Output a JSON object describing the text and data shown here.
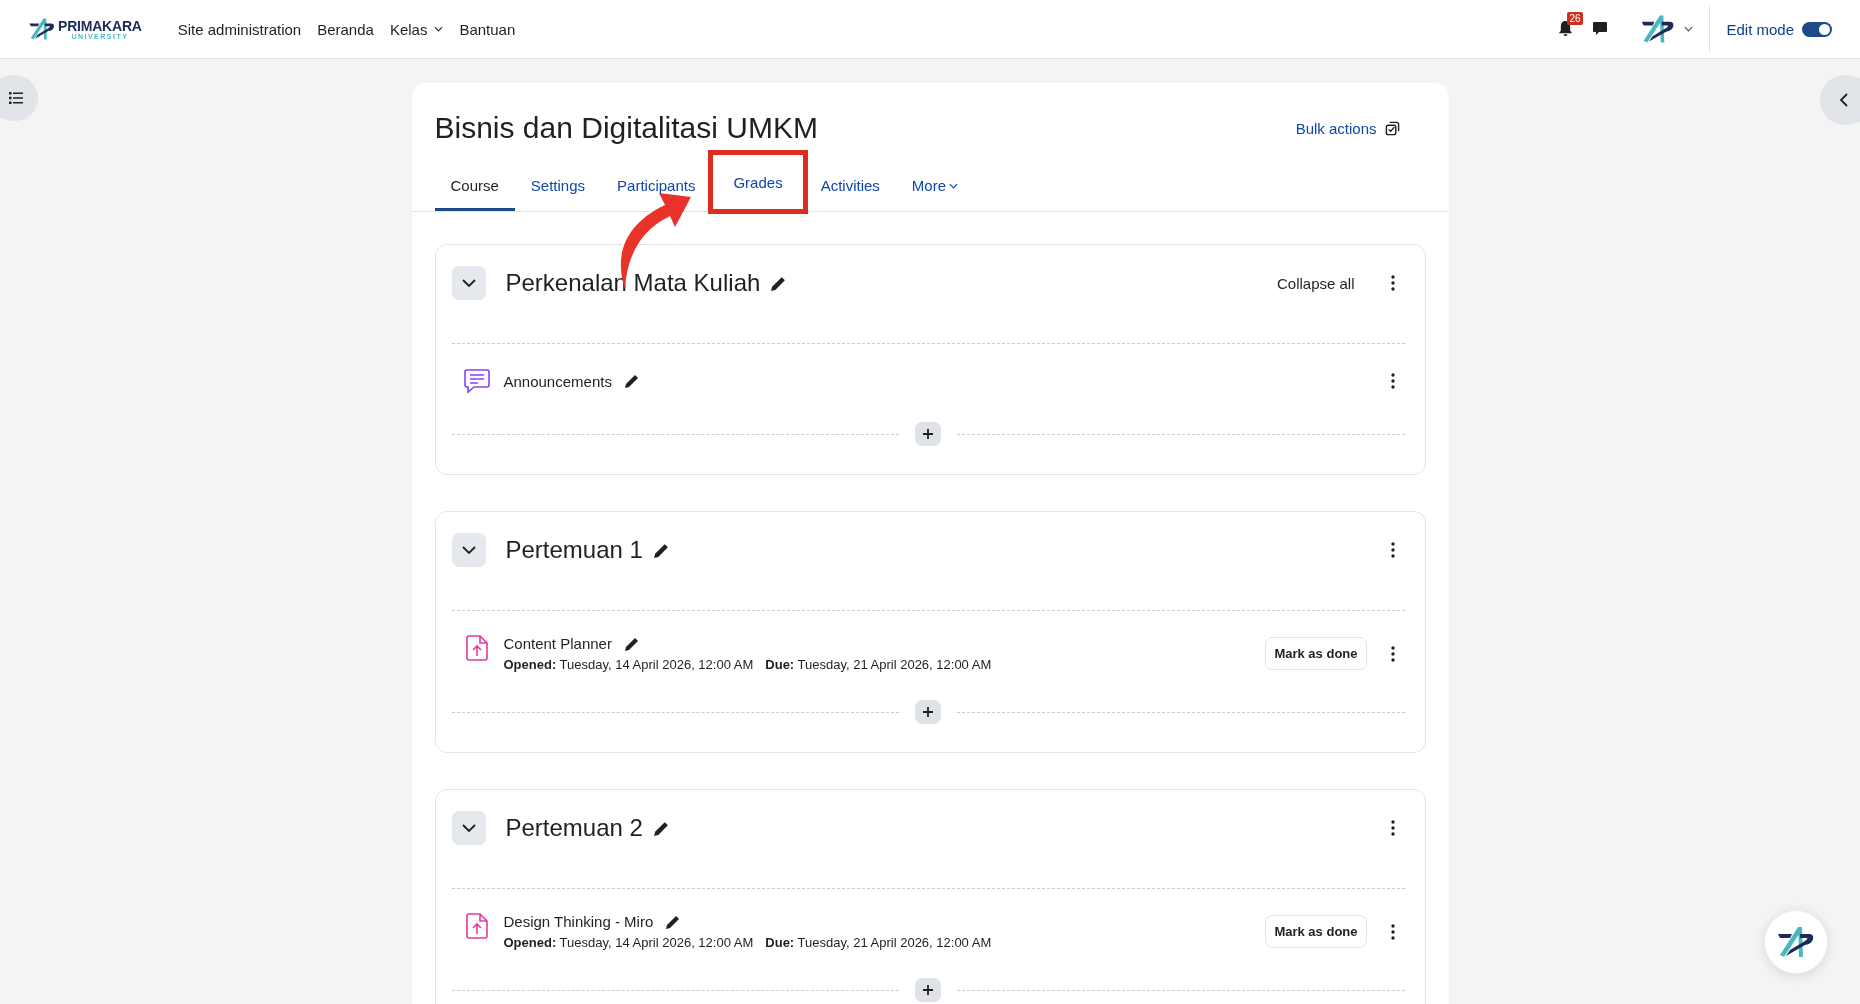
{
  "navbar": {
    "logo": {
      "name": "PRIMAKARA",
      "sub": "UNIVERSITY"
    },
    "links": [
      {
        "label": "Site administration",
        "dropdown": false
      },
      {
        "label": "Beranda",
        "dropdown": false
      },
      {
        "label": "Kelas",
        "dropdown": true
      },
      {
        "label": "Bantuan",
        "dropdown": false
      }
    ],
    "notifications": {
      "count": "26"
    },
    "edit_mode": {
      "label": "Edit mode",
      "on": true
    }
  },
  "course": {
    "title": "Bisnis dan Digitalitasi UMKM",
    "bulk_actions": "Bulk actions",
    "tabs": [
      {
        "label": "Course",
        "selected": true,
        "dropdown": false,
        "highlighted": false
      },
      {
        "label": "Settings",
        "selected": false,
        "dropdown": false,
        "highlighted": false
      },
      {
        "label": "Participants",
        "selected": false,
        "dropdown": false,
        "highlighted": false
      },
      {
        "label": "Grades",
        "selected": false,
        "dropdown": false,
        "highlighted": true
      },
      {
        "label": "Activities",
        "selected": false,
        "dropdown": false,
        "highlighted": false
      },
      {
        "label": "More",
        "selected": false,
        "dropdown": true,
        "highlighted": false
      }
    ],
    "collapse_all": "Collapse all",
    "sections": [
      {
        "title": "Perkenalan Mata Kuliah",
        "expanded": true,
        "activities": [
          {
            "kind": "forum",
            "name": "Announcements"
          }
        ]
      },
      {
        "title": "Pertemuan 1",
        "expanded": true,
        "activities": [
          {
            "kind": "assignment",
            "name": "Content Planner",
            "opened": "**Opened:** Tuesday, 14 April 2026, 12:00 AM",
            "due": "**Due:** Tuesday, 21 April 2026, 12:00 AM",
            "mark_button": "Mark as done"
          }
        ]
      },
      {
        "title": "Pertemuan 2",
        "expanded": true,
        "activities": [
          {
            "kind": "assignment",
            "name": "Design Thinking - Miro",
            "opened": "**Opened:** Tuesday, 14 April 2026, 12:00 AM",
            "due": "**Due:** Tuesday, 21 April 2026, 12:00 AM",
            "mark_button": "Mark as done"
          }
        ]
      }
    ]
  }
}
